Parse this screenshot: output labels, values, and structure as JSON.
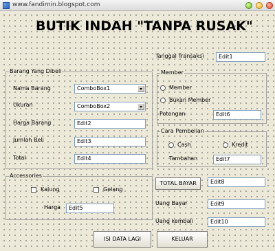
{
  "window": {
    "title": "www.fandimin.blogspot.com"
  },
  "header": {
    "title": "BUTIK INDAH \"TANPA RUSAK\""
  },
  "transaction": {
    "date_label": "Tanggal Transaksi",
    "date_value": "Edit1"
  },
  "barang": {
    "group_title": "Barang Yang Dibeli",
    "nama_label": "Nama Barang",
    "nama_value": "ComboBox1",
    "ukuran_label": "Ukuran",
    "ukuran_value": "ComboBox2",
    "harga_label": "Harga Barang",
    "harga_value": "Edit2",
    "jumlah_label": "Jumlah Beli",
    "jumlah_value": "Edit3",
    "total_label": "Total",
    "total_value": "Edit4"
  },
  "member": {
    "group_title": "Member",
    "member_option": "Member",
    "bukan_option": "Bukan Member",
    "potongan_label": "Potongan",
    "potongan_value": "Edit6"
  },
  "pembelian": {
    "group_title": "Cara Pembelian",
    "cash_option": "Cash",
    "kredit_option": "Kredit",
    "tambahan_label": "Tambahan",
    "tambahan_value": "Edit7"
  },
  "accessories": {
    "group_title": "Accessories",
    "kalung_label": "Kalung",
    "gelang_label": "Gelang",
    "harga_label": "Harga",
    "harga_value": "Edit5"
  },
  "payment": {
    "total_bayar_button": "TOTAL BAYAR",
    "total_bayar_value": "Edit8",
    "uang_bayar_label": "Uang Bayar",
    "uang_bayar_value": "Edit9",
    "uang_kembali_label": "Uang kembali",
    "uang_kembali_value": "Edit10"
  },
  "actions": {
    "isi_label": "ISI DATA LAGI",
    "keluar_label": "KELUAR"
  }
}
